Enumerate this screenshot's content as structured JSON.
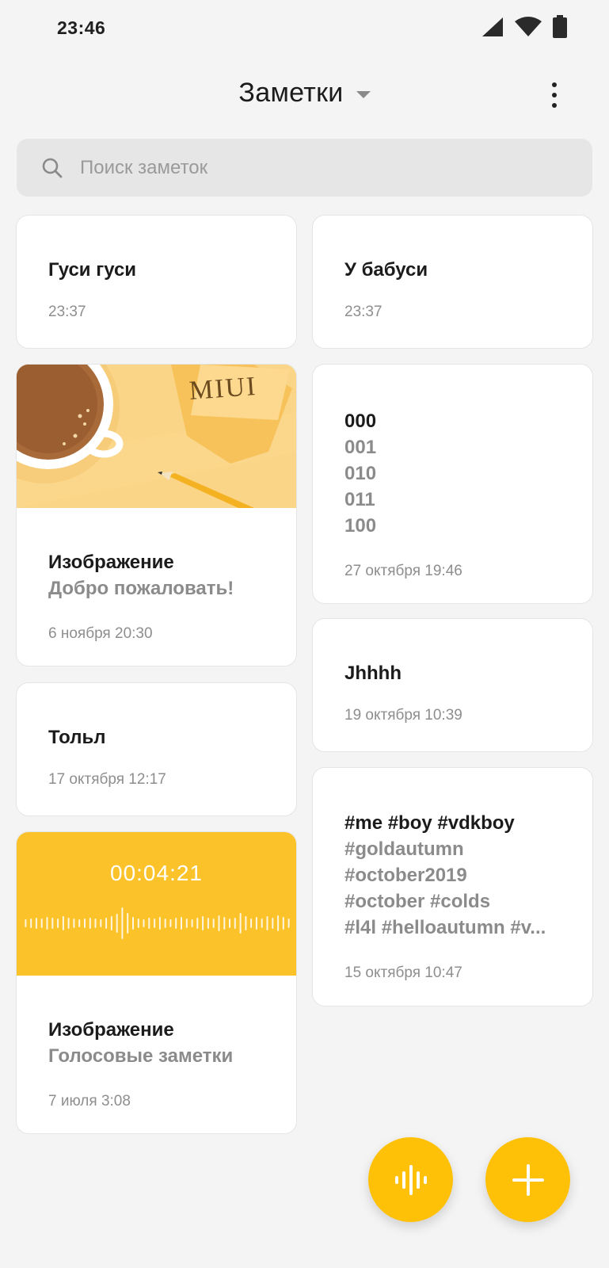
{
  "status_bar": {
    "time": "23:46"
  },
  "header": {
    "title": "Заметки"
  },
  "search": {
    "placeholder": "Поиск заметок"
  },
  "notes": {
    "n1": {
      "title": "Гуси гуси",
      "time": "23:37"
    },
    "n2": {
      "title": "У бабуси",
      "time": "23:37"
    },
    "n3": {
      "image_text": "MIUI",
      "title": "Изображение",
      "subtitle": "Добро пожаловать!",
      "time": "6 ноября 20:30"
    },
    "n4": {
      "lines": [
        "000",
        "001",
        "010",
        "011",
        "100"
      ],
      "time": "27 октября 19:46"
    },
    "n5": {
      "title": "Jhhhh",
      "time": "19 октября 10:39"
    },
    "n6": {
      "title": "Тольл",
      "time": "17 октября 12:17"
    },
    "n7": {
      "lines": [
        "#me #boy #vdkboy",
        "#goldautumn",
        "#october2019",
        "#october #colds",
        "#l4l #helloautumn #v..."
      ],
      "time": "15 октября 10:47"
    },
    "n8": {
      "duration": "00:04:21",
      "title": "Изображение",
      "subtitle": "Голосовые заметки",
      "time": "7 июля 3:08"
    }
  },
  "colors": {
    "accent": "#ffc107",
    "background": "#f4f4f4",
    "card": "#ffffff",
    "voice_banner": "#fbc22a"
  },
  "icons": {
    "search": "search-icon",
    "menu": "more-vertical-icon",
    "voice_fab": "voice-wave-icon",
    "add_fab": "plus-icon"
  }
}
